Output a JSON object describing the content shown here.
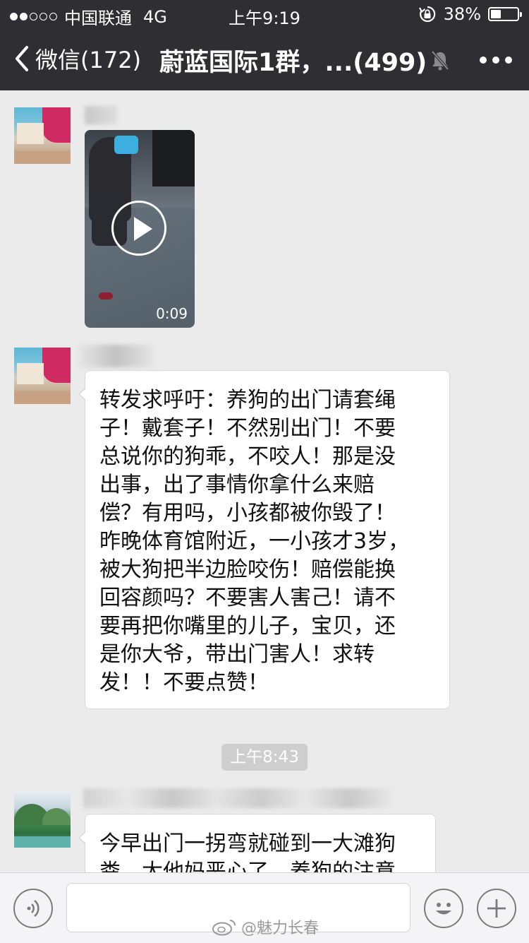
{
  "status_bar": {
    "carrier": "中国联通",
    "network": "4G",
    "time": "上午9:19",
    "battery_percent": "38%",
    "battery_level": 0.38,
    "signal_bars_filled": 2
  },
  "nav": {
    "back_label": "微信(172)",
    "title": "蔚蓝国际1群，...(499)",
    "icons": [
      "chevron-left-icon",
      "mute-bell-icon",
      "more-icon"
    ]
  },
  "messages": [
    {
      "type": "video",
      "duration": "0:09"
    },
    {
      "type": "text",
      "lines": [
        "转发求呼吁：养狗的出门请套绳",
        "子！戴套子！不然别出门！不要",
        "总说你的狗乖，不咬人！那是没",
        "出事，出了事情你拿什么来赔",
        "偿？有用吗，小孩都被你毁了！",
        "昨晚体育馆附近，一小孩才3岁，",
        "被大狗把半边脸咬伤！赔偿能换",
        "回容颜吗？不要害人害己！请不",
        "要再把你嘴里的儿子，宝贝，还",
        "是你大爷，带出门害人！求转",
        "发！！不要点赞！"
      ]
    },
    {
      "type": "text",
      "lines": [
        "今早出门一拐弯就碰到一大滩狗",
        "粪，太他妈恶心了，养狗的注意"
      ]
    }
  ],
  "timestamp": "上午8:43",
  "input_bar": {
    "icons": [
      "voice-icon",
      "emoji-icon",
      "plus-icon"
    ]
  },
  "watermark": "@魅力长春",
  "colors": {
    "nav_bg": "#2f2f33",
    "chat_bg": "#ebebeb",
    "bubble_bg": "#ffffff",
    "timestamp_bg": "#cecece"
  }
}
